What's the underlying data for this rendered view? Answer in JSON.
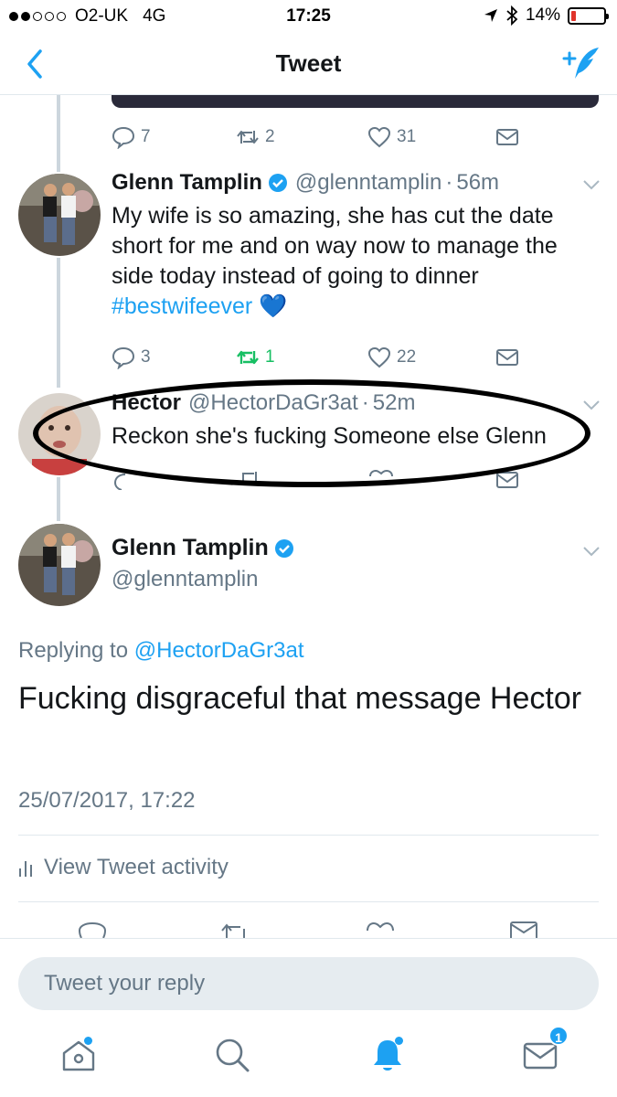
{
  "status_bar": {
    "carrier": "O2-UK",
    "network": "4G",
    "time": "17:25",
    "battery": "14%",
    "battery_level": 0.14
  },
  "nav": {
    "title": "Tweet",
    "back_icon": "chevron-left-icon",
    "compose_icon": "compose-tweet-icon"
  },
  "prev_tweet_actions": {
    "replies": "7",
    "retweets": "2",
    "likes": "31"
  },
  "thread": [
    {
      "name": "Glenn Tamplin",
      "handle": "@glenntamplin",
      "time": "56m",
      "text_before": "My wife is so amazing, she has cut the date short for me and on way now to manage the side today instead of going to dinner ",
      "hashtag": "#bestwifeever",
      "emoji": "💙",
      "replies": "3",
      "retweets": "1",
      "likes": "22"
    },
    {
      "name": "Hector",
      "handle": "@HectorDaGr3at",
      "time": "52m",
      "text": "Reckon she's fucking Someone else Glenn"
    }
  ],
  "main_tweet": {
    "name": "Glenn Tamplin",
    "handle": "@glenntamplin",
    "replying_label": "Replying to",
    "replying_to": "@HectorDaGr3at",
    "text": "Fucking disgraceful that message Hector",
    "timestamp": "25/07/2017, 17:22",
    "activity_label": "View Tweet activity"
  },
  "reply": {
    "placeholder": "Tweet your reply"
  },
  "tabbar": {
    "messages_badge": "1"
  },
  "colors": {
    "accent": "#1da1f2",
    "retweet": "#17bf63",
    "muted": "#657786"
  }
}
